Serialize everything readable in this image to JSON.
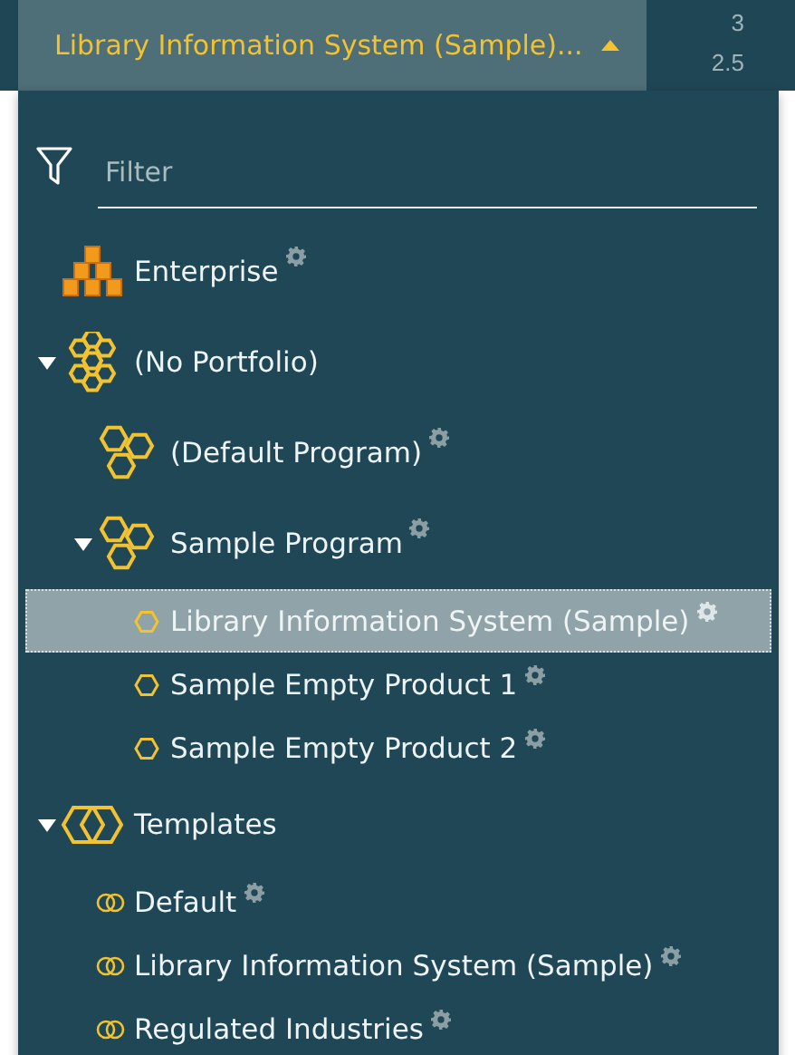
{
  "background": {
    "header_values": [
      "3",
      "2.5"
    ]
  },
  "selector": {
    "label": "Library Information System (Sample)...",
    "expanded": true
  },
  "filter": {
    "placeholder": "Filter"
  },
  "tree": [
    {
      "kind": "enterprise",
      "label": "Enterprise",
      "settings": true,
      "selected": false
    },
    {
      "kind": "portfolio",
      "label": "(No Portfolio)",
      "settings": false,
      "selected": false,
      "expanded": true,
      "children": [
        {
          "kind": "program",
          "label": "(Default Program)",
          "settings": true,
          "selected": false
        },
        {
          "kind": "program",
          "label": "Sample Program",
          "settings": true,
          "selected": false,
          "expanded": true,
          "children": [
            {
              "kind": "product",
              "label": "Library Information System (Sample)",
              "settings": true,
              "selected": true
            },
            {
              "kind": "product",
              "label": "Sample Empty Product 1",
              "settings": true,
              "selected": false
            },
            {
              "kind": "product",
              "label": "Sample Empty Product 2",
              "settings": true,
              "selected": false
            }
          ]
        }
      ]
    },
    {
      "kind": "templates",
      "label": "Templates",
      "settings": false,
      "selected": false,
      "expanded": true,
      "children": [
        {
          "kind": "template",
          "label": "Default",
          "settings": true,
          "selected": false
        },
        {
          "kind": "template",
          "label": "Library Information System (Sample)",
          "settings": true,
          "selected": false
        },
        {
          "kind": "template",
          "label": "Regulated Industries",
          "settings": true,
          "selected": false
        }
      ]
    }
  ]
}
